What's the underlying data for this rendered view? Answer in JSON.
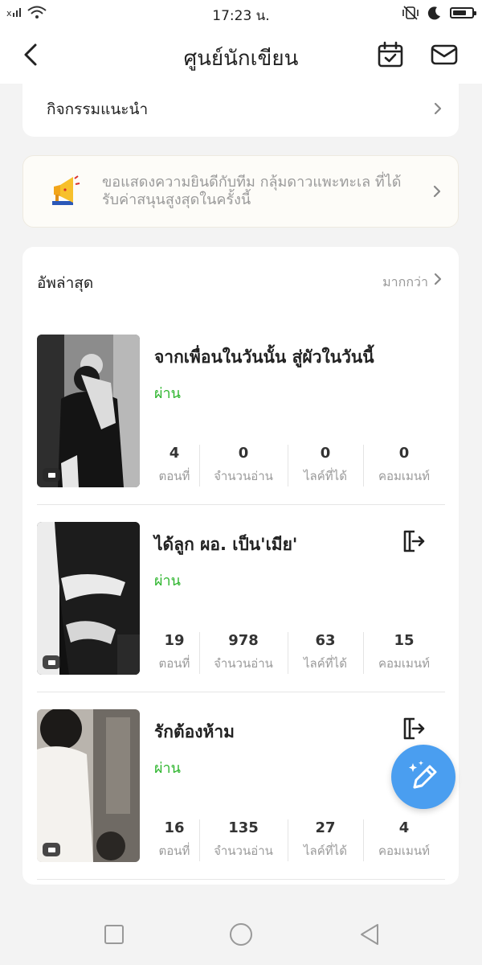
{
  "status_bar": {
    "signal_text": "ᕽıl",
    "time": "17:23 น.",
    "icons": [
      "signal-icon",
      "wifi-icon",
      "vibrate-off-icon",
      "moon-icon",
      "battery-icon"
    ]
  },
  "header": {
    "title": "ศูนย์นักเขียน",
    "icons": [
      "back-arrow-icon",
      "calendar-check-icon",
      "mail-icon"
    ]
  },
  "activity": {
    "label": "กิจกรรมแนะนำ"
  },
  "notice": {
    "text": "ขอแสดงความยินดีกับทีม กลุ้มดาวแพะทะเล ที่ได้รับค่าสนุนสูงสุดในครั้งนี้",
    "icon": "megaphone-icon"
  },
  "updates": {
    "title": "อัพล่าสุด",
    "more": "มากกว่า",
    "stories": [
      {
        "title": "จากเพื่อนในวันนั้น สู่ผัวในวันนี้",
        "status": "ผ่าน",
        "has_export_icon": false,
        "stats": [
          {
            "value": "4",
            "label": "ตอนที่"
          },
          {
            "value": "0",
            "label": "จำนวนอ่าน"
          },
          {
            "value": "0",
            "label": "ไลค์ที่ได้"
          },
          {
            "value": "0",
            "label": "คอมเมนท์"
          }
        ]
      },
      {
        "title": "ได้ลูก ผอ. เป็น'เมีย'",
        "status": "ผ่าน",
        "has_export_icon": true,
        "stats": [
          {
            "value": "19",
            "label": "ตอนที่"
          },
          {
            "value": "978",
            "label": "จำนวนอ่าน"
          },
          {
            "value": "63",
            "label": "ไลค์ที่ได้"
          },
          {
            "value": "15",
            "label": "คอมเมนท์"
          }
        ]
      },
      {
        "title": "รักต้องห้าม",
        "status": "ผ่าน",
        "has_export_icon": true,
        "stats": [
          {
            "value": "16",
            "label": "ตอนที่"
          },
          {
            "value": "135",
            "label": "จำนวนอ่าน"
          },
          {
            "value": "27",
            "label": "ไลค์ที่ได้"
          },
          {
            "value": "4",
            "label": "คอมเมนท์"
          }
        ]
      }
    ]
  },
  "fab": {
    "icon": "pen-sparkle-icon"
  },
  "system_nav": {
    "icons": [
      "recent-apps-icon",
      "home-icon",
      "back-icon"
    ]
  },
  "colors": {
    "status_passed": "#2db52d",
    "fab": "#4a9ef0",
    "muted_text": "#9a9a9a"
  }
}
